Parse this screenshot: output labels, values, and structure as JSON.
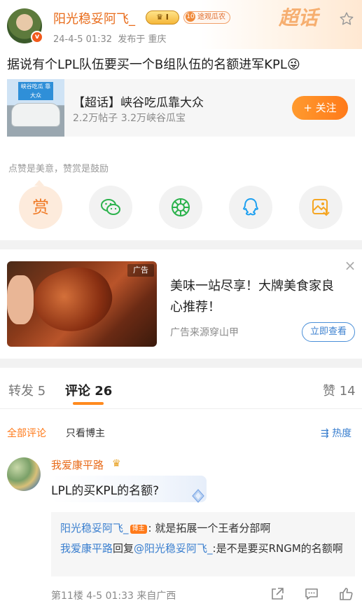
{
  "post": {
    "username": "阳光稳妥阿飞_",
    "level_badge": "I",
    "fan_badge_level": "10",
    "fan_badge_label": "途观瓜农",
    "time": "24-4-5 01:32",
    "location": "发布于 重庆",
    "chaohua_logo": "超话",
    "text": "据说有个LPL队伍要买一个B组队伍的名额进军KPL😜"
  },
  "topic": {
    "thumb_tag": "峡谷吃瓜 靠大众",
    "title": "【超话】峡谷吃瓜靠大众",
    "stats": "2.2万帖子 3.2万峡谷瓜宝",
    "follow_label": "+ 关注"
  },
  "reward_tip": "点赞是美意，赞赏是鼓励",
  "share": {
    "reward_glyph": "赏",
    "icons": [
      "reward-icon",
      "wechat-icon",
      "moments-icon",
      "qq-icon",
      "save-image-icon"
    ]
  },
  "ad": {
    "tag": "广告",
    "title": "美味一站尽享！大牌美食家良心推荐！",
    "source": "广告来源穿山甲",
    "button": "立即查看",
    "close": "×"
  },
  "tabs": {
    "repost": "转发 5",
    "comments": "评论 26",
    "likes": "赞 14"
  },
  "filters": {
    "all": "全部评论",
    "owner_only": "只看博主",
    "sort": "热度"
  },
  "comment": {
    "username": "我爱康平路",
    "text": "LPL的买KPL的名额?",
    "reply1_name": "阳光稳妥阿飞_",
    "reply1_badge": "博主",
    "reply1_text": ": 就是拓展一个王者分部啊",
    "reply2_name": "我爱康平路",
    "reply2_mid": "回复",
    "reply2_target": "@阳光稳妥阿飞_",
    "reply2_text": ":是不是要买RNGM的名额啊",
    "footer": "第11楼  4-5 01:33  来自广西"
  },
  "colors": {
    "accent": "#ff7a1a",
    "link": "#3a7fcf",
    "username": "#e86b1a"
  }
}
